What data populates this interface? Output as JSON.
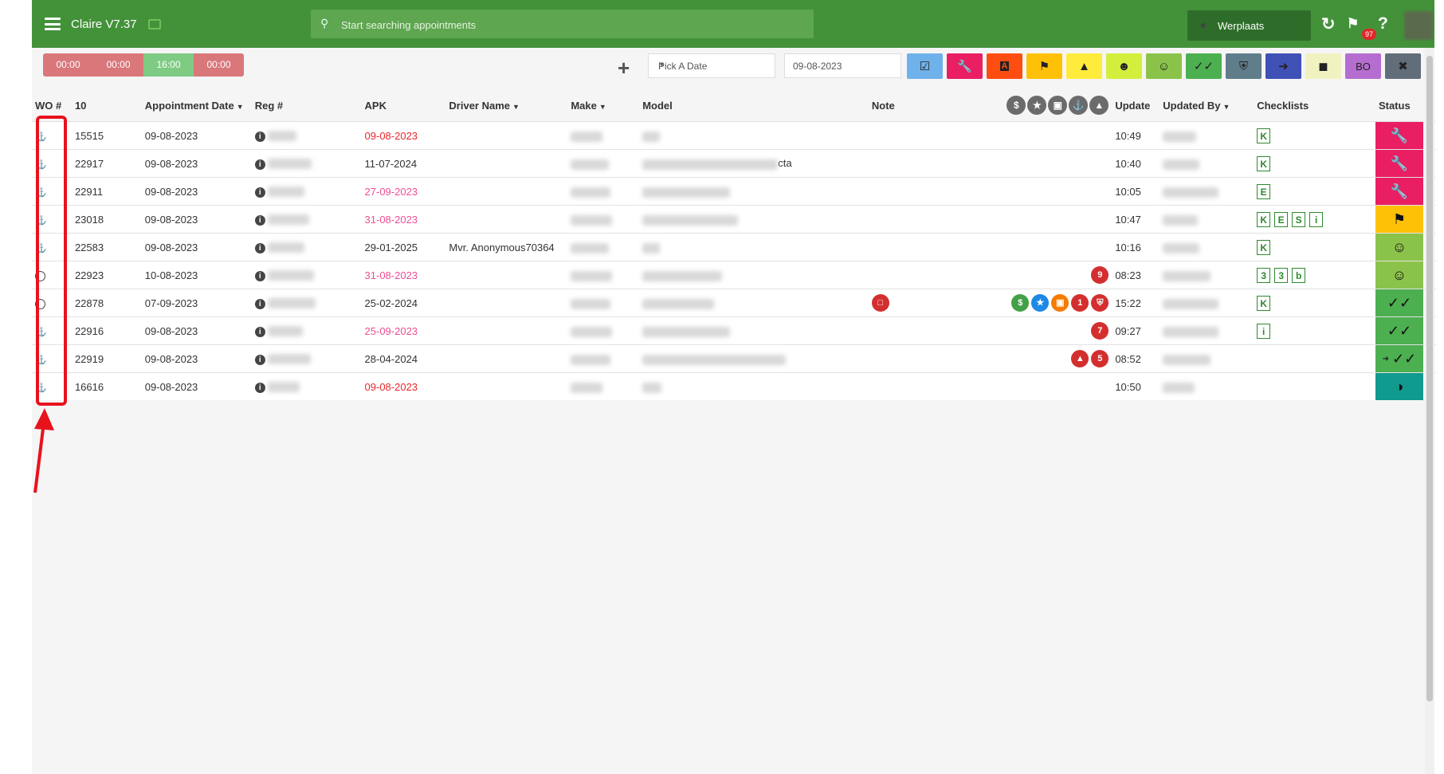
{
  "header": {
    "title": "Claire V7.37",
    "search_placeholder": "Start searching appointments",
    "location": "Werplaats",
    "notifications_count": "97"
  },
  "timers": [
    "00:00",
    "00:00",
    "16:00",
    "00:00"
  ],
  "toolbar": {
    "date_picker_label": "Pick A Date",
    "date_value": "09-08-2023",
    "bo_label": "BO",
    "filter_colors": [
      "#6fb1ea",
      "#e91e63",
      "#ff4d11",
      "#ffc107",
      "#ffeb3b",
      "#d4ee3e",
      "#8bc34a",
      "#4caf50",
      "#607d8b",
      "#3f51b5",
      "#f0f3c0",
      "#b66dd0",
      "#616e7a"
    ]
  },
  "table": {
    "headers": {
      "wo": "WO #",
      "count": "10",
      "date": "Appointment Date",
      "reg": "Reg #",
      "apk": "APK",
      "driver": "Driver Name",
      "make": "Make",
      "model": "Model",
      "note": "Note",
      "update": "Update",
      "updated_by": "Updated By",
      "checklists": "Checklists",
      "status": "Status"
    },
    "rows": [
      {
        "wo": "15515",
        "date": "09-08-2023",
        "apk": "09-08-2023",
        "apk_color": "red",
        "driver": "",
        "time": "10:49",
        "checklists": [
          "K"
        ],
        "status_color": "#e91e63",
        "status_icon": "wrench-icon",
        "model_note": ""
      },
      {
        "wo": "22917",
        "date": "09-08-2023",
        "apk": "11-07-2024",
        "apk_color": "normal",
        "driver": "",
        "time": "10:40",
        "checklists": [
          "K"
        ],
        "status_color": "#e91e63",
        "status_icon": "wrench-icon",
        "model_note": "cta"
      },
      {
        "wo": "22911",
        "date": "09-08-2023",
        "apk": "27-09-2023",
        "apk_color": "pink",
        "driver": "",
        "time": "10:05",
        "checklists": [
          "E"
        ],
        "status_color": "#e91e63",
        "status_icon": "wrench-icon",
        "model_note": ""
      },
      {
        "wo": "23018",
        "date": "09-08-2023",
        "apk": "31-08-2023",
        "apk_color": "pink",
        "driver": "",
        "time": "10:47",
        "checklists": [
          "K",
          "E",
          "S",
          "i"
        ],
        "status_color": "#ffc107",
        "status_icon": "tag-icon",
        "model_note": ""
      },
      {
        "wo": "22583",
        "date": "09-08-2023",
        "apk": "29-01-2025",
        "apk_color": "normal",
        "driver": "Mvr. Anonymous70364",
        "time": "10:16",
        "checklists": [
          "K"
        ],
        "status_color": "#8bc34a",
        "status_icon": "smiley-icon",
        "model_note": ""
      },
      {
        "wo": "22923",
        "date": "10-08-2023",
        "apk": "31-08-2023",
        "apk_color": "pink",
        "driver": "",
        "time": "08:23",
        "checklists": [
          "3",
          "3",
          "b"
        ],
        "status_color": "#8bc34a",
        "status_icon": "smiley-icon",
        "model_note": ""
      },
      {
        "wo": "22878",
        "date": "07-09-2023",
        "apk": "25-02-2024",
        "apk_color": "normal",
        "driver": "",
        "time": "15:22",
        "checklists": [
          "K"
        ],
        "status_color": "#4caf50",
        "status_icon": "double-check-icon",
        "model_note": ""
      },
      {
        "wo": "22916",
        "date": "09-08-2023",
        "apk": "25-09-2023",
        "apk_color": "pink",
        "driver": "",
        "time": "09:27",
        "checklists": [
          "i"
        ],
        "status_color": "#4caf50",
        "status_icon": "double-check-icon",
        "model_note": ""
      },
      {
        "wo": "22919",
        "date": "09-08-2023",
        "apk": "28-04-2024",
        "apk_color": "normal",
        "driver": "",
        "time": "08:52",
        "checklists": [],
        "status_color": "#4caf50",
        "status_icon": "double-check-icon",
        "model_note": ""
      },
      {
        "wo": "16616",
        "date": "09-08-2023",
        "apk": "09-08-2023",
        "apk_color": "red",
        "driver": "",
        "time": "10:50",
        "checklists": [],
        "status_color": "#119a8e",
        "status_icon": "moon-icon",
        "model_note": ""
      }
    ],
    "indicator_badges": {
      "row6": "9",
      "row7_count": "1",
      "row8": "7",
      "row9": "5"
    }
  }
}
